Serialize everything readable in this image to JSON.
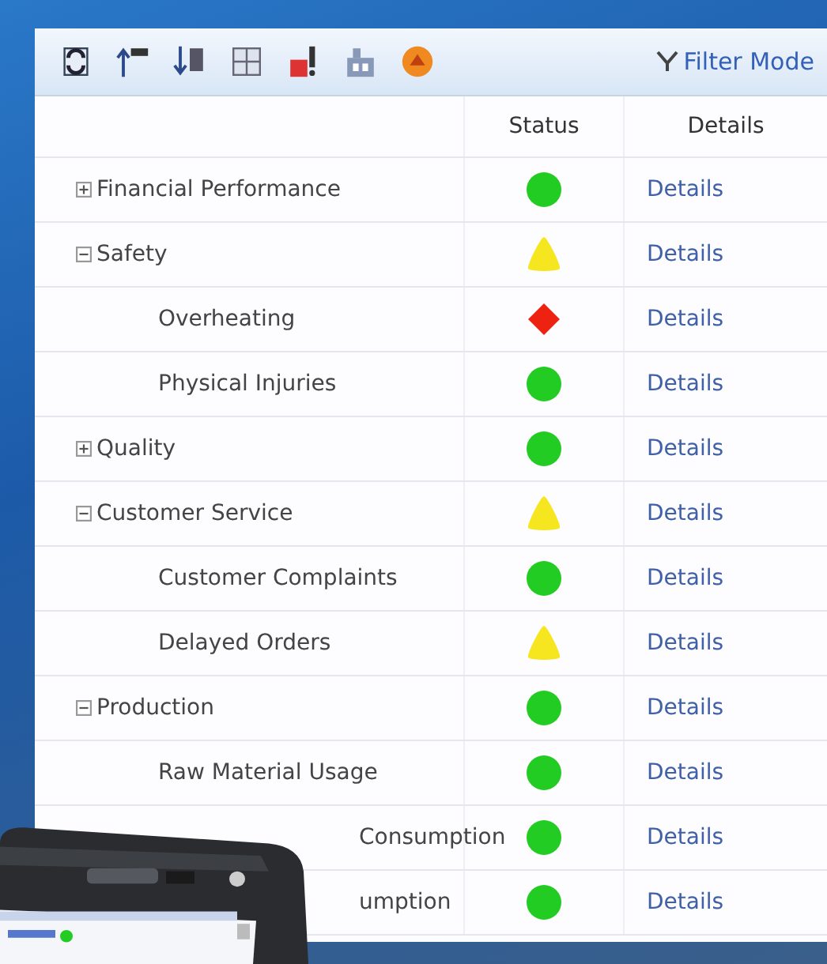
{
  "toolbar": {
    "filter": {
      "label": "Filter Mode"
    }
  },
  "table": {
    "columns": [
      "Status",
      "Details"
    ],
    "rows": [
      {
        "name": "Financial Performance",
        "expanded": false,
        "status": {
          "kind": "circle",
          "color": "#22cc22"
        },
        "details": "Details"
      },
      {
        "name": "Safety",
        "expanded": true,
        "status": {
          "kind": "triangle",
          "color": "#f5e620"
        },
        "details": "Details",
        "children": [
          {
            "name": "Overheating",
            "status": {
              "kind": "diamond",
              "color": "#ee2211"
            },
            "details": "Details"
          },
          {
            "name": "Physical Injuries",
            "status": {
              "kind": "circle",
              "color": "#22cc22"
            },
            "details": "Details"
          }
        ]
      },
      {
        "name": "Quality",
        "expanded": false,
        "status": {
          "kind": "circle",
          "color": "#22cc22"
        },
        "details": "Details"
      },
      {
        "name": "Customer Service",
        "expanded": true,
        "status": {
          "kind": "triangle",
          "color": "#f5e620"
        },
        "details": "Details",
        "children": [
          {
            "name": "Customer Complaints",
            "status": {
              "kind": "circle",
              "color": "#22cc22"
            },
            "details": "Details"
          },
          {
            "name": "Delayed Orders",
            "status": {
              "kind": "triangle",
              "color": "#f5e620"
            },
            "details": "Details"
          }
        ]
      },
      {
        "name": "Production",
        "expanded": true,
        "status": {
          "kind": "circle",
          "color": "#22cc22"
        },
        "details": "Details",
        "children": [
          {
            "name": "Raw Material Usage",
            "status": {
              "kind": "circle",
              "color": "#22cc22"
            },
            "details": "Details"
          },
          {
            "name": "Consumption",
            "status": {
              "kind": "circle",
              "color": "#22cc22"
            },
            "details": "Details"
          },
          {
            "name": "umption",
            "status": {
              "kind": "circle",
              "color": "#22cc22"
            },
            "details": "Details"
          }
        ]
      }
    ]
  }
}
